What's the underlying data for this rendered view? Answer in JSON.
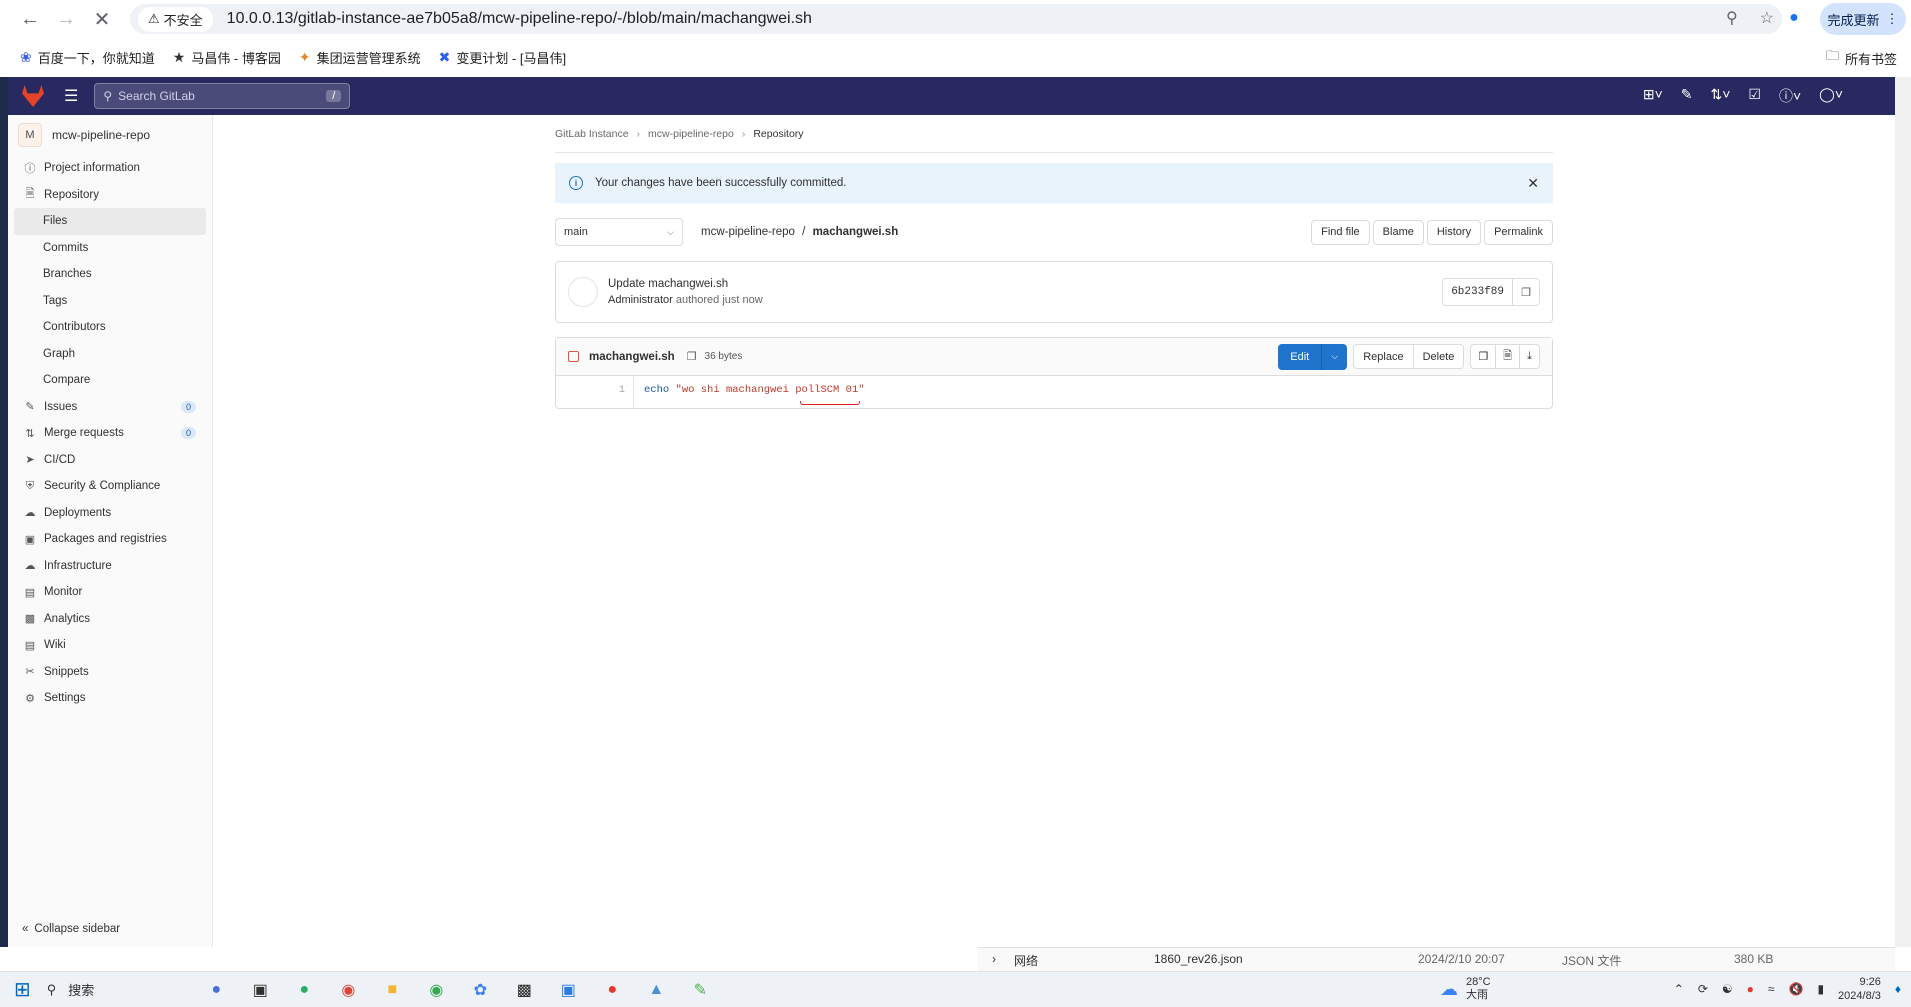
{
  "browser": {
    "insecure_label": "不安全",
    "url": "10.0.0.13/gitlab-instance-ae7b05a8/mcw-pipeline-repo/-/blob/main/machangwei.sh",
    "update_label": "完成更新",
    "bookmarks": [
      "百度一下，你就知道",
      "马昌伟 - 博客园",
      "集团运营管理系统",
      "变更计划 - [马昌伟]"
    ],
    "all_bookmarks": "所有书签"
  },
  "gitlab": {
    "search_placeholder": "Search GitLab",
    "search_shortcut": "/"
  },
  "sidebar": {
    "avatar_letter": "M",
    "project_name": "mcw-pipeline-repo",
    "items": [
      {
        "label": "Project information",
        "icon": "info-icon"
      },
      {
        "label": "Repository",
        "icon": "doc-icon"
      },
      {
        "label": "Files",
        "sub": true,
        "active": true
      },
      {
        "label": "Commits",
        "sub": true
      },
      {
        "label": "Branches",
        "sub": true
      },
      {
        "label": "Tags",
        "sub": true
      },
      {
        "label": "Contributors",
        "sub": true
      },
      {
        "label": "Graph",
        "sub": true
      },
      {
        "label": "Compare",
        "sub": true
      },
      {
        "label": "Issues",
        "icon": "issues-icon",
        "count": "0"
      },
      {
        "label": "Merge requests",
        "icon": "merge-icon",
        "count": "0"
      },
      {
        "label": "CI/CD",
        "icon": "rocket-icon"
      },
      {
        "label": "Security & Compliance",
        "icon": "shield-icon"
      },
      {
        "label": "Deployments",
        "icon": "deploy-icon"
      },
      {
        "label": "Packages and registries",
        "icon": "package-icon"
      },
      {
        "label": "Infrastructure",
        "icon": "cloud-icon"
      },
      {
        "label": "Monitor",
        "icon": "monitor-icon"
      },
      {
        "label": "Analytics",
        "icon": "chart-icon"
      },
      {
        "label": "Wiki",
        "icon": "book-icon"
      },
      {
        "label": "Snippets",
        "icon": "scissors-icon"
      },
      {
        "label": "Settings",
        "icon": "gear-icon"
      }
    ],
    "collapse_label": "Collapse sidebar"
  },
  "breadcrumb": [
    "GitLab Instance",
    "mcw-pipeline-repo",
    "Repository"
  ],
  "alert": "Your changes have been successfully committed.",
  "file_bar": {
    "branch": "main",
    "repo": "mcw-pipeline-repo",
    "separator": "/",
    "file": "machangwei.sh",
    "actions": [
      "Find file",
      "Blame",
      "History",
      "Permalink"
    ]
  },
  "commit": {
    "title": "Update machangwei.sh",
    "author": "Administrator",
    "meta": "authored just now",
    "sha": "6b233f89"
  },
  "blob": {
    "name": "machangwei.sh",
    "size": "36 bytes",
    "edit_label": "Edit",
    "replace_label": "Replace",
    "delete_label": "Delete",
    "line_number": "1",
    "code_keyword": "echo",
    "code_string": "\"wo shi machangwei pollSCM 01\""
  },
  "background_window": {
    "folder": "网络",
    "filename": "1860_rev26.json",
    "date": "2024/2/10 20:07",
    "type": "JSON 文件",
    "size": "380 KB"
  },
  "taskbar": {
    "search_label": "搜索",
    "temperature": "28°C",
    "weather": "大雨",
    "time": "9:26",
    "date": "2024/8/3"
  }
}
